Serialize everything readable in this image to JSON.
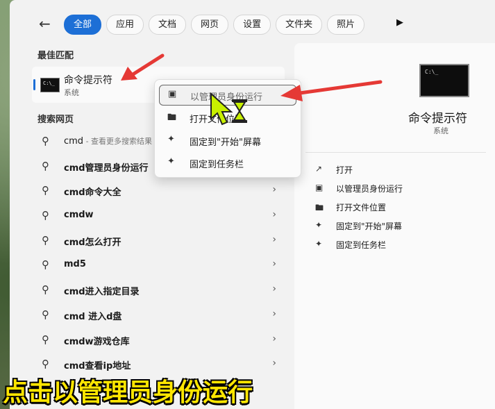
{
  "tabs": [
    {
      "label": "全部",
      "active": true
    },
    {
      "label": "应用"
    },
    {
      "label": "文档"
    },
    {
      "label": "网页"
    },
    {
      "label": "设置"
    },
    {
      "label": "文件夹"
    },
    {
      "label": "照片"
    }
  ],
  "best_match": {
    "section_label": "最佳匹配",
    "title": "命令提示符",
    "subtitle": "系统",
    "icon": "terminal-icon"
  },
  "web": {
    "section_label": "搜索网页",
    "items": [
      {
        "bold": "cmd",
        "rest": " - 查看更多搜索结果"
      },
      {
        "bold": "cmd管理员身份运行",
        "rest": ""
      },
      {
        "bold": "cmd命令大全",
        "rest": ""
      },
      {
        "bold": "cmdw",
        "rest": ""
      },
      {
        "bold": "cmd怎么打开",
        "rest": ""
      },
      {
        "bold": "md5",
        "rest": ""
      },
      {
        "bold": "cmd进入指定目录",
        "rest": ""
      },
      {
        "bold": "cmd 进入d盘",
        "rest": ""
      },
      {
        "bold": "cmdw游戏仓库",
        "rest": ""
      },
      {
        "bold": "cmd查看ip地址",
        "rest": ""
      }
    ]
  },
  "context_menu": [
    {
      "label": "以管理员身份运行",
      "icon": "shield-window-icon",
      "highlighted": true
    },
    {
      "label": "打开文件位置",
      "icon": "folder-icon"
    },
    {
      "label": "固定到\"开始\"屏幕",
      "icon": "pin-icon"
    },
    {
      "label": "固定到任务栏",
      "icon": "pin-icon"
    }
  ],
  "detail": {
    "title": "命令提示符",
    "subtitle": "系统",
    "actions": [
      {
        "label": "打开",
        "icon": "open-external-icon"
      },
      {
        "label": "以管理员身份运行",
        "icon": "shield-window-icon"
      },
      {
        "label": "打开文件位置",
        "icon": "folder-icon"
      },
      {
        "label": "固定到\"开始\"屏幕",
        "icon": "pin-icon"
      },
      {
        "label": "固定到任务栏",
        "icon": "pin-icon"
      }
    ]
  },
  "caption": "点击以管理员身份运行",
  "colors": {
    "accent": "#1d6fd6",
    "arrow": "#e53935",
    "caption": "#ffe600"
  }
}
